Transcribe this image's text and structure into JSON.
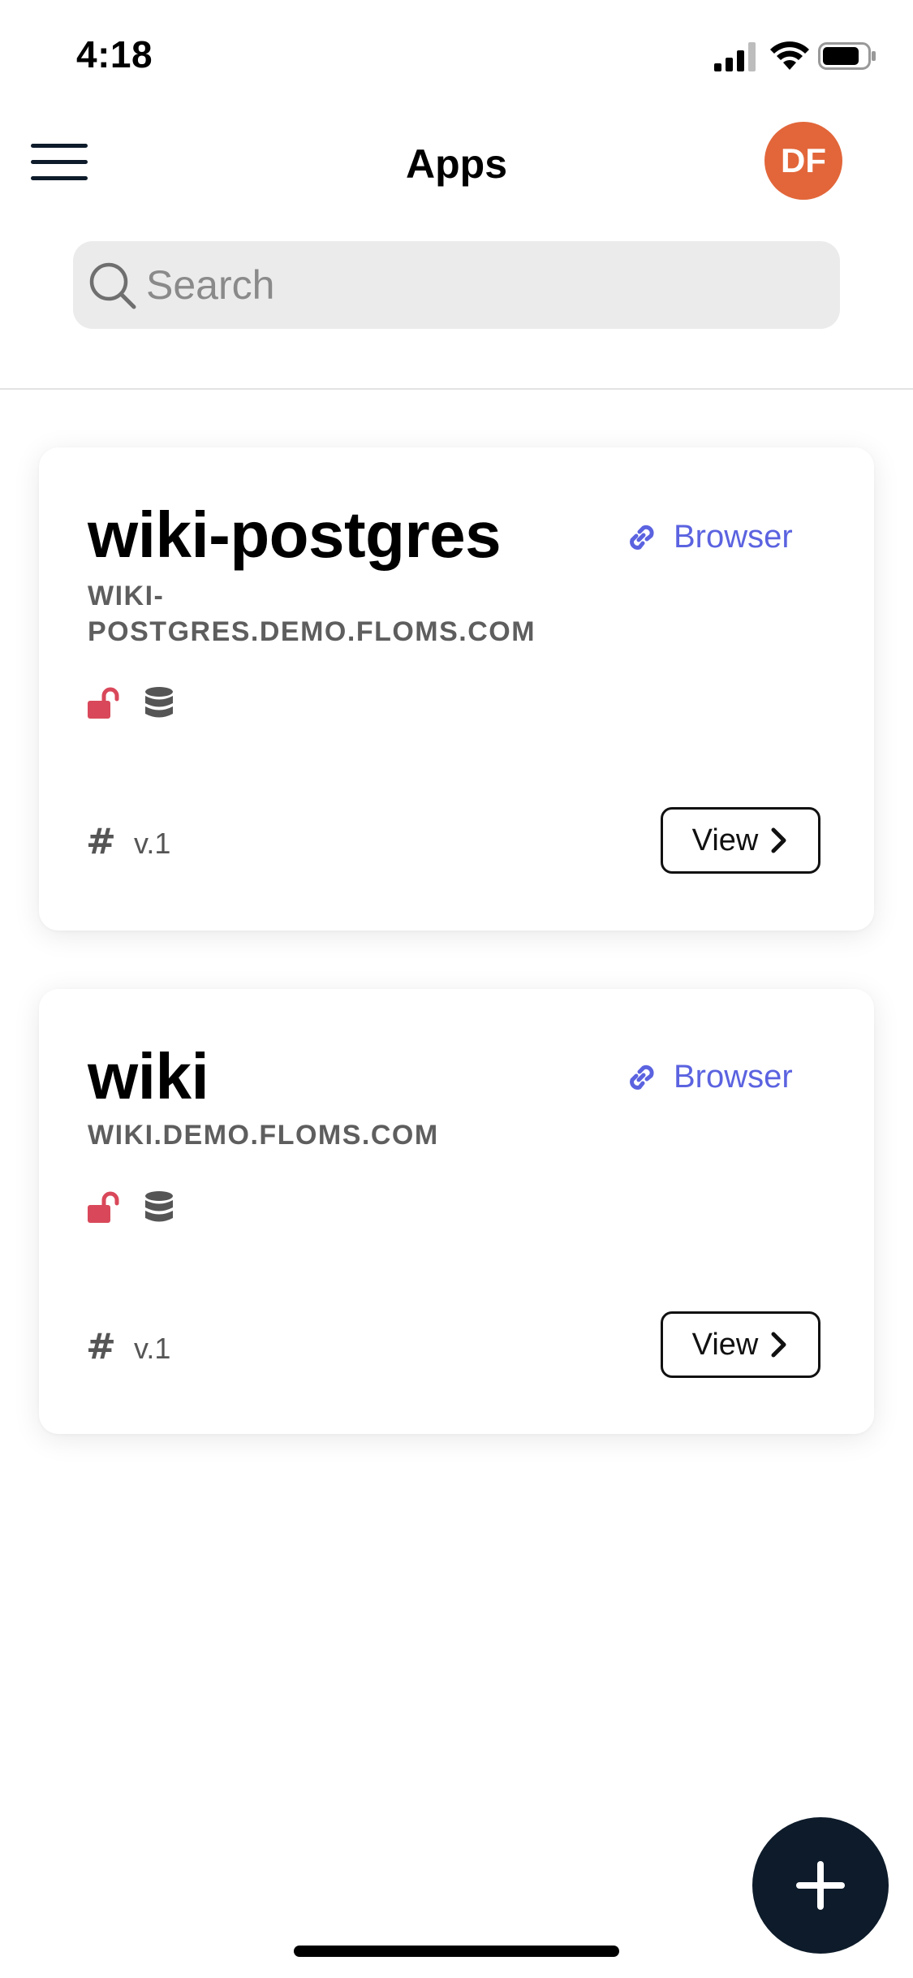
{
  "status_bar": {
    "time": "4:18",
    "icons": [
      "cellular-signal-icon",
      "wifi-icon",
      "battery-icon"
    ]
  },
  "header": {
    "title": "Apps",
    "menu_icon": "hamburger-menu-icon",
    "avatar_initials": "DF",
    "avatar_color": "#e2663a"
  },
  "search": {
    "placeholder": "Search",
    "value": "",
    "icon": "search-icon"
  },
  "apps": [
    {
      "name": "wiki-postgres",
      "host": "WIKI-POSTGRES.DEMO.FLOMS.COM",
      "browser_label": "Browser",
      "status_icons": [
        "unlocked-padlock-icon",
        "database-icon"
      ],
      "version": "v.1",
      "view_label": "View"
    },
    {
      "name": "wiki",
      "host": "WIKI.DEMO.FLOMS.COM",
      "browser_label": "Browser",
      "status_icons": [
        "unlocked-padlock-icon",
        "database-icon"
      ],
      "version": "v.1",
      "view_label": "View"
    }
  ],
  "fab": {
    "icon": "plus-icon",
    "color": "#0d1b2a"
  },
  "colors": {
    "link": "#5b63e0",
    "unlock_icon": "#d9485a",
    "database_icon": "#555555",
    "muted_text": "#5e5e5e"
  }
}
